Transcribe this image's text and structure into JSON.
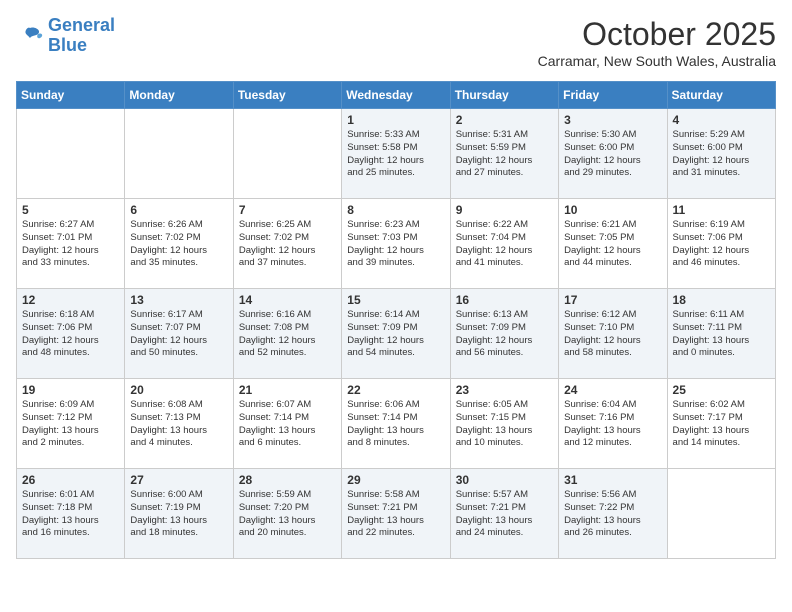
{
  "header": {
    "logo_line1": "General",
    "logo_line2": "Blue",
    "month": "October 2025",
    "location": "Carramar, New South Wales, Australia"
  },
  "days_of_week": [
    "Sunday",
    "Monday",
    "Tuesday",
    "Wednesday",
    "Thursday",
    "Friday",
    "Saturday"
  ],
  "weeks": [
    [
      {
        "day": "",
        "text": ""
      },
      {
        "day": "",
        "text": ""
      },
      {
        "day": "",
        "text": ""
      },
      {
        "day": "1",
        "text": "Sunrise: 5:33 AM\nSunset: 5:58 PM\nDaylight: 12 hours\nand 25 minutes."
      },
      {
        "day": "2",
        "text": "Sunrise: 5:31 AM\nSunset: 5:59 PM\nDaylight: 12 hours\nand 27 minutes."
      },
      {
        "day": "3",
        "text": "Sunrise: 5:30 AM\nSunset: 6:00 PM\nDaylight: 12 hours\nand 29 minutes."
      },
      {
        "day": "4",
        "text": "Sunrise: 5:29 AM\nSunset: 6:00 PM\nDaylight: 12 hours\nand 31 minutes."
      }
    ],
    [
      {
        "day": "5",
        "text": "Sunrise: 6:27 AM\nSunset: 7:01 PM\nDaylight: 12 hours\nand 33 minutes."
      },
      {
        "day": "6",
        "text": "Sunrise: 6:26 AM\nSunset: 7:02 PM\nDaylight: 12 hours\nand 35 minutes."
      },
      {
        "day": "7",
        "text": "Sunrise: 6:25 AM\nSunset: 7:02 PM\nDaylight: 12 hours\nand 37 minutes."
      },
      {
        "day": "8",
        "text": "Sunrise: 6:23 AM\nSunset: 7:03 PM\nDaylight: 12 hours\nand 39 minutes."
      },
      {
        "day": "9",
        "text": "Sunrise: 6:22 AM\nSunset: 7:04 PM\nDaylight: 12 hours\nand 41 minutes."
      },
      {
        "day": "10",
        "text": "Sunrise: 6:21 AM\nSunset: 7:05 PM\nDaylight: 12 hours\nand 44 minutes."
      },
      {
        "day": "11",
        "text": "Sunrise: 6:19 AM\nSunset: 7:06 PM\nDaylight: 12 hours\nand 46 minutes."
      }
    ],
    [
      {
        "day": "12",
        "text": "Sunrise: 6:18 AM\nSunset: 7:06 PM\nDaylight: 12 hours\nand 48 minutes."
      },
      {
        "day": "13",
        "text": "Sunrise: 6:17 AM\nSunset: 7:07 PM\nDaylight: 12 hours\nand 50 minutes."
      },
      {
        "day": "14",
        "text": "Sunrise: 6:16 AM\nSunset: 7:08 PM\nDaylight: 12 hours\nand 52 minutes."
      },
      {
        "day": "15",
        "text": "Sunrise: 6:14 AM\nSunset: 7:09 PM\nDaylight: 12 hours\nand 54 minutes."
      },
      {
        "day": "16",
        "text": "Sunrise: 6:13 AM\nSunset: 7:09 PM\nDaylight: 12 hours\nand 56 minutes."
      },
      {
        "day": "17",
        "text": "Sunrise: 6:12 AM\nSunset: 7:10 PM\nDaylight: 12 hours\nand 58 minutes."
      },
      {
        "day": "18",
        "text": "Sunrise: 6:11 AM\nSunset: 7:11 PM\nDaylight: 13 hours\nand 0 minutes."
      }
    ],
    [
      {
        "day": "19",
        "text": "Sunrise: 6:09 AM\nSunset: 7:12 PM\nDaylight: 13 hours\nand 2 minutes."
      },
      {
        "day": "20",
        "text": "Sunrise: 6:08 AM\nSunset: 7:13 PM\nDaylight: 13 hours\nand 4 minutes."
      },
      {
        "day": "21",
        "text": "Sunrise: 6:07 AM\nSunset: 7:14 PM\nDaylight: 13 hours\nand 6 minutes."
      },
      {
        "day": "22",
        "text": "Sunrise: 6:06 AM\nSunset: 7:14 PM\nDaylight: 13 hours\nand 8 minutes."
      },
      {
        "day": "23",
        "text": "Sunrise: 6:05 AM\nSunset: 7:15 PM\nDaylight: 13 hours\nand 10 minutes."
      },
      {
        "day": "24",
        "text": "Sunrise: 6:04 AM\nSunset: 7:16 PM\nDaylight: 13 hours\nand 12 minutes."
      },
      {
        "day": "25",
        "text": "Sunrise: 6:02 AM\nSunset: 7:17 PM\nDaylight: 13 hours\nand 14 minutes."
      }
    ],
    [
      {
        "day": "26",
        "text": "Sunrise: 6:01 AM\nSunset: 7:18 PM\nDaylight: 13 hours\nand 16 minutes."
      },
      {
        "day": "27",
        "text": "Sunrise: 6:00 AM\nSunset: 7:19 PM\nDaylight: 13 hours\nand 18 minutes."
      },
      {
        "day": "28",
        "text": "Sunrise: 5:59 AM\nSunset: 7:20 PM\nDaylight: 13 hours\nand 20 minutes."
      },
      {
        "day": "29",
        "text": "Sunrise: 5:58 AM\nSunset: 7:21 PM\nDaylight: 13 hours\nand 22 minutes."
      },
      {
        "day": "30",
        "text": "Sunrise: 5:57 AM\nSunset: 7:21 PM\nDaylight: 13 hours\nand 24 minutes."
      },
      {
        "day": "31",
        "text": "Sunrise: 5:56 AM\nSunset: 7:22 PM\nDaylight: 13 hours\nand 26 minutes."
      },
      {
        "day": "",
        "text": ""
      }
    ]
  ]
}
